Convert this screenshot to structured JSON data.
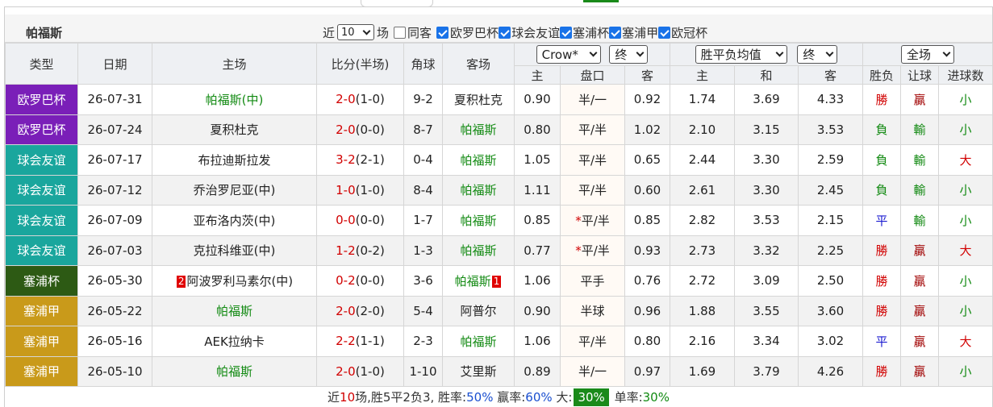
{
  "team_title": "帕福斯",
  "filters": {
    "recent_prefix": "近",
    "recent_count": "10",
    "recent_suffix": "场",
    "same_home_label": "同客",
    "same_home_checked": false,
    "competitions": [
      {
        "label": "欧罗巴杯",
        "checked": true
      },
      {
        "label": "球会友谊",
        "checked": true
      },
      {
        "label": "塞浦杯",
        "checked": true
      },
      {
        "label": "塞浦甲",
        "checked": true
      },
      {
        "label": "欧冠杯",
        "checked": true
      }
    ]
  },
  "header": {
    "type": "类型",
    "date": "日期",
    "home": "主场",
    "score": "比分(半场)",
    "corners": "角球",
    "away": "客场",
    "company_select": "Crow*",
    "handicap_stage_select": "终",
    "odds_type_select": "胜平负均值",
    "odds_stage_select": "终",
    "scope_select": "全场",
    "handicap_home": "主",
    "handicap_line": "盘口",
    "handicap_away": "客",
    "odds_home": "主",
    "odds_draw": "和",
    "odds_away": "客",
    "result": "胜负",
    "ah_result": "让球",
    "goals": "进球数"
  },
  "type_colors": {
    "欧罗巴杯": "#7a1fb8",
    "球会友谊": "#1aa69d",
    "塞浦杯": "#2d5a14",
    "塞浦甲": "#c99a1a"
  },
  "matches": [
    {
      "type": "欧罗巴杯",
      "type_key": "euro",
      "date": "26-07-31",
      "home": "帕福斯(中)",
      "home_green": true,
      "home_card": "",
      "score_ft": "2-0",
      "score_ht": "(1-0)",
      "corners": "9-2",
      "away": "夏积杜克",
      "away_green": false,
      "away_card": "",
      "hc_home": "0.90",
      "hc_line": "半/一",
      "hc_star": "",
      "hc_away": "0.92",
      "o_home": "1.74",
      "o_draw": "3.69",
      "o_away": "4.33",
      "result": "勝",
      "ah": "贏",
      "goals": "小"
    },
    {
      "type": "欧罗巴杯",
      "type_key": "euro",
      "date": "26-07-24",
      "home": "夏积杜克",
      "home_green": false,
      "home_card": "",
      "score_ft": "2-0",
      "score_ht": "(0-0)",
      "corners": "8-7",
      "away": "帕福斯",
      "away_green": true,
      "away_card": "",
      "hc_home": "0.80",
      "hc_line": "平/半",
      "hc_star": "",
      "hc_away": "1.02",
      "o_home": "2.10",
      "o_draw": "3.15",
      "o_away": "3.53",
      "result": "負",
      "ah": "輸",
      "goals": "小"
    },
    {
      "type": "球会友谊",
      "type_key": "club",
      "date": "26-07-17",
      "home": "布拉迪斯拉发",
      "home_green": false,
      "home_card": "",
      "score_ft": "3-2",
      "score_ht": "(2-1)",
      "corners": "0-4",
      "away": "帕福斯",
      "away_green": true,
      "away_card": "",
      "hc_home": "1.05",
      "hc_line": "平/半",
      "hc_star": "",
      "hc_away": "0.65",
      "o_home": "2.44",
      "o_draw": "3.30",
      "o_away": "2.59",
      "result": "負",
      "ah": "輸",
      "goals": "大"
    },
    {
      "type": "球会友谊",
      "type_key": "club",
      "date": "26-07-12",
      "home": "乔治罗尼亚(中)",
      "home_green": false,
      "home_card": "",
      "score_ft": "1-0",
      "score_ht": "(1-0)",
      "corners": "8-4",
      "away": "帕福斯",
      "away_green": true,
      "away_card": "",
      "hc_home": "1.11",
      "hc_line": "平/半",
      "hc_star": "",
      "hc_away": "0.60",
      "o_home": "2.61",
      "o_draw": "3.30",
      "o_away": "2.45",
      "result": "負",
      "ah": "輸",
      "goals": "小"
    },
    {
      "type": "球会友谊",
      "type_key": "club",
      "date": "26-07-09",
      "home": "亚布洛内茨(中)",
      "home_green": false,
      "home_card": "",
      "score_ft": "0-0",
      "score_ht": "(0-0)",
      "corners": "1-7",
      "away": "帕福斯",
      "away_green": true,
      "away_card": "",
      "hc_home": "0.85",
      "hc_line": "平/半",
      "hc_star": "*",
      "hc_away": "0.85",
      "o_home": "2.82",
      "o_draw": "3.53",
      "o_away": "2.15",
      "result": "平",
      "ah": "輸",
      "goals": "小"
    },
    {
      "type": "球会友谊",
      "type_key": "club",
      "date": "26-07-03",
      "home": "克拉科维亚(中)",
      "home_green": false,
      "home_card": "",
      "score_ft": "1-2",
      "score_ht": "(0-2)",
      "corners": "1-3",
      "away": "帕福斯",
      "away_green": true,
      "away_card": "",
      "hc_home": "0.77",
      "hc_line": "平/半",
      "hc_star": "*",
      "hc_away": "0.93",
      "o_home": "2.73",
      "o_draw": "3.32",
      "o_away": "2.25",
      "result": "勝",
      "ah": "贏",
      "goals": "大"
    },
    {
      "type": "塞浦杯",
      "type_key": "cup",
      "date": "26-05-30",
      "home": "阿波罗利马素尔(中)",
      "home_green": false,
      "home_card": "2",
      "score_ft": "0-2",
      "score_ht": "(0-0)",
      "corners": "3-6",
      "away": "帕福斯",
      "away_green": true,
      "away_card": "1",
      "hc_home": "1.06",
      "hc_line": "平手",
      "hc_star": "",
      "hc_away": "0.76",
      "o_home": "2.72",
      "o_draw": "3.09",
      "o_away": "2.50",
      "result": "勝",
      "ah": "贏",
      "goals": "小"
    },
    {
      "type": "塞浦甲",
      "type_key": "league",
      "date": "26-05-22",
      "home": "帕福斯",
      "home_green": true,
      "home_card": "",
      "score_ft": "2-0",
      "score_ht": "(2-0)",
      "corners": "5-4",
      "away": "阿普尔",
      "away_green": false,
      "away_card": "",
      "hc_home": "0.90",
      "hc_line": "半球",
      "hc_star": "",
      "hc_away": "0.96",
      "o_home": "1.88",
      "o_draw": "3.55",
      "o_away": "3.60",
      "result": "勝",
      "ah": "贏",
      "goals": "小"
    },
    {
      "type": "塞浦甲",
      "type_key": "league",
      "date": "26-05-16",
      "home": "AEK拉纳卡",
      "home_green": false,
      "home_card": "",
      "score_ft": "2-2",
      "score_ht": "(1-1)",
      "corners": "2-3",
      "away": "帕福斯",
      "away_green": true,
      "away_card": "",
      "hc_home": "1.06",
      "hc_line": "平/半",
      "hc_star": "",
      "hc_away": "0.80",
      "o_home": "2.16",
      "o_draw": "3.34",
      "o_away": "3.02",
      "result": "平",
      "ah": "贏",
      "goals": "大"
    },
    {
      "type": "塞浦甲",
      "type_key": "league",
      "date": "26-05-10",
      "home": "帕福斯",
      "home_green": true,
      "home_card": "",
      "score_ft": "2-0",
      "score_ht": "(1-0)",
      "corners": "1-10",
      "away": "艾里斯",
      "away_green": false,
      "away_card": "",
      "hc_home": "0.89",
      "hc_line": "半/一",
      "hc_star": "",
      "hc_away": "0.97",
      "o_home": "1.69",
      "o_draw": "3.79",
      "o_away": "4.26",
      "result": "勝",
      "ah": "贏",
      "goals": "小"
    }
  ],
  "summary": {
    "prefix": "近",
    "count": "10",
    "text1": "场,胜5平2负3, 胜率:",
    "win_rate": "50%",
    "text2": " 赢率:",
    "cover_rate": "60%",
    "text3": " 大:",
    "over_rate": "30%",
    "text4": " 单率:",
    "odd_rate": "30%"
  }
}
